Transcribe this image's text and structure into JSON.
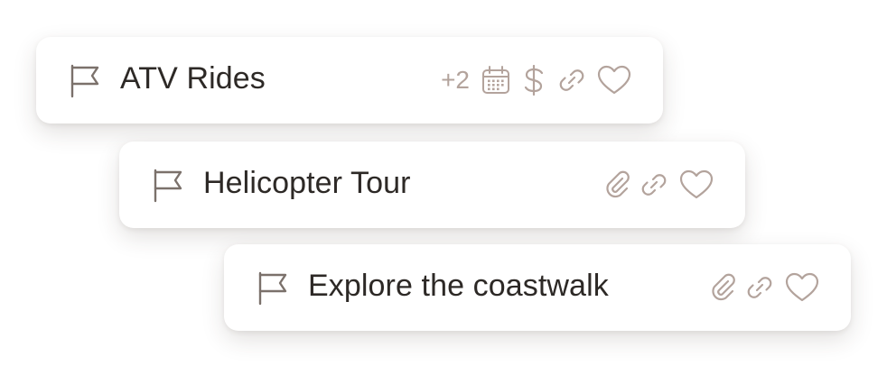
{
  "colors": {
    "card_background": "#ffffff",
    "title_text": "#2d2926",
    "flag_icon": "#7b716b",
    "action_icons": "#b3a39c"
  },
  "items": [
    {
      "title": "ATV Rides",
      "extra_count": "+2",
      "icons": [
        "flag-icon",
        "calendar-icon",
        "dollar-icon",
        "link-icon",
        "heart-icon"
      ]
    },
    {
      "title": "Helicopter Tour",
      "icons": [
        "flag-icon",
        "paperclip-icon",
        "link-icon",
        "heart-icon"
      ]
    },
    {
      "title": "Explore the coastwalk",
      "icons": [
        "flag-icon",
        "paperclip-icon",
        "link-icon",
        "heart-icon"
      ]
    }
  ]
}
